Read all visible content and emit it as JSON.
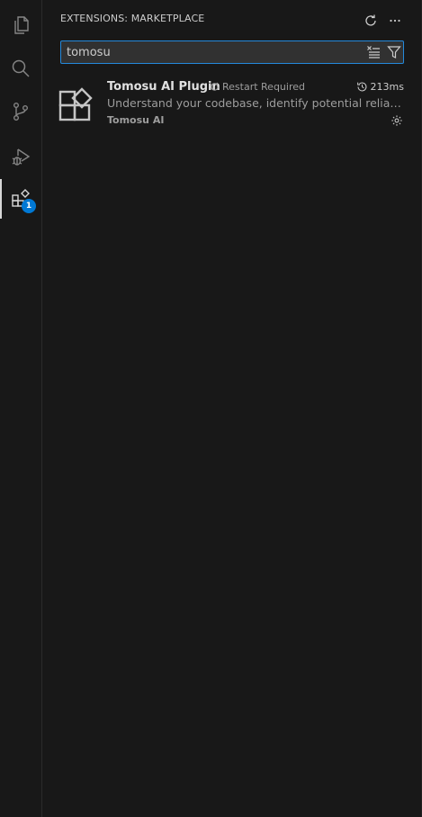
{
  "activity_bar": {
    "items": [
      {
        "name": "explorer",
        "icon": "files-icon"
      },
      {
        "name": "search",
        "icon": "search-icon"
      },
      {
        "name": "source-control",
        "icon": "source-control-icon"
      },
      {
        "name": "run-debug",
        "icon": "run-debug-icon"
      },
      {
        "name": "extensions",
        "icon": "extensions-icon",
        "active": true,
        "badge": "1"
      }
    ]
  },
  "sidebar": {
    "title": "EXTENSIONS: MARKETPLACE",
    "actions": [
      {
        "name": "refresh",
        "icon": "refresh-icon"
      },
      {
        "name": "more-actions",
        "icon": "ellipsis-icon"
      }
    ],
    "search": {
      "value": "tomosu",
      "clear_icon": "clear-filter-icon",
      "filter_icon": "filter-icon"
    },
    "extensions": [
      {
        "name": "Tomosu AI Plugin",
        "status": "Restart Required",
        "time": "213ms",
        "description": "Understand your codebase, identify potential reliability issues, and improve code quality",
        "publisher": "Tomosu AI",
        "icon": "extension-default-icon"
      }
    ]
  },
  "colors": {
    "background": "#181818",
    "accent": "#0078d4",
    "focus_border": "#2489db",
    "text": "#cccccc",
    "muted_text": "#9d9d9d"
  }
}
